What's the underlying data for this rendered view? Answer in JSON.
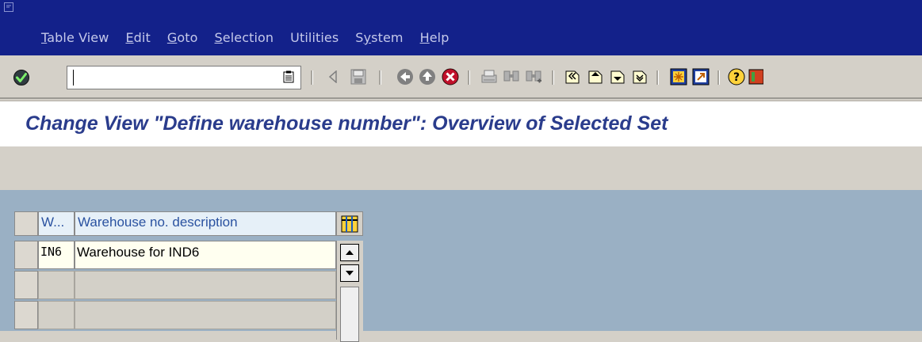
{
  "menubar": {
    "items": [
      {
        "pre": "",
        "ul": "T",
        "post": "able View"
      },
      {
        "pre": "",
        "ul": "E",
        "post": "dit"
      },
      {
        "pre": "",
        "ul": "G",
        "post": "oto"
      },
      {
        "pre": "",
        "ul": "S",
        "post": "election"
      },
      {
        "pre": "Utilities",
        "ul": "",
        "post": ""
      },
      {
        "pre": "S",
        "ul": "y",
        "post": "stem"
      },
      {
        "pre": "",
        "ul": "H",
        "post": "elp"
      }
    ]
  },
  "toolbar": {
    "command_value": "",
    "icons": [
      "enter-icon",
      "command-history-icon",
      "back-arrow-icon",
      "save-icon",
      "back-icon",
      "exit-icon",
      "cancel-icon",
      "print-icon",
      "find-icon",
      "find-next-icon",
      "first-page-icon",
      "previous-page-icon",
      "next-page-icon",
      "last-page-icon",
      "create-session-icon",
      "create-shortcut-icon",
      "help-icon",
      "layout-menu-icon"
    ]
  },
  "title": "Change View \"Define warehouse number\": Overview of Selected Set",
  "table": {
    "columns": [
      "W...",
      "Warehouse no. description"
    ],
    "rows": [
      {
        "code": "IN6",
        "description": "Warehouse for IND6"
      }
    ]
  },
  "colors": {
    "menubar": "#13218a",
    "title": "#2a3c8c",
    "content_bg": "#9ab0c4"
  }
}
